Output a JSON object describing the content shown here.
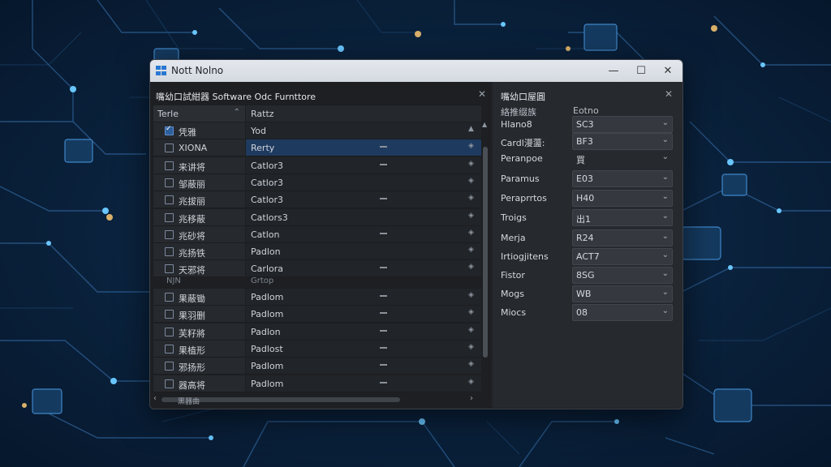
{
  "window": {
    "title": "Nott Nolno"
  },
  "left_panel": {
    "title": "嘴幼口試紺器 Software Odc Furnttore",
    "col1_header": "Terle",
    "col2_header": "Rattz",
    "rows": [
      {
        "name": "凭雅",
        "value": "Yod",
        "checked": true
      },
      {
        "name": "XIONA",
        "value": "Rerty",
        "selected": true
      },
      {
        "name": "来讲将",
        "value": "Catlor3"
      },
      {
        "name": "邹蔽丽",
        "value": "Catlor3"
      },
      {
        "name": "兆拔丽",
        "value": "Catlor3"
      },
      {
        "name": "兆移蔽",
        "value": "Catlors3"
      },
      {
        "name": "兆砂将",
        "value": "Catlon"
      },
      {
        "name": "兆扬铁",
        "value": "Padlon"
      },
      {
        "name": "天邪将",
        "value": "Carlora"
      },
      {
        "name": "果蔽锄",
        "value": "Padlom"
      },
      {
        "name": "果羽删",
        "value": "Padlom"
      },
      {
        "name": "芙籽將",
        "value": "Padlon"
      },
      {
        "name": "果植形",
        "value": "Padlost"
      },
      {
        "name": "邪扬形",
        "value": "Padlom"
      },
      {
        "name": "器高将",
        "value": "Padlom"
      }
    ],
    "group_left": "NJN",
    "group_right": "Grtop",
    "hscroll_label": "黑器曲"
  },
  "right_panel": {
    "title": "嘴幼口屋圓",
    "header_label": "絡推缀族",
    "header_value": "Eotno",
    "properties": [
      {
        "label": "Hlano8",
        "value": "SC3"
      },
      {
        "label": "Cardl漫蘯:",
        "value": "BF3"
      },
      {
        "label": "Peranpoe",
        "value": "買",
        "flat": true
      },
      {
        "label": "Paramus",
        "value": "E03"
      },
      {
        "label": "Peraprrtos",
        "value": "H40"
      },
      {
        "label": "Troigs",
        "value": "出1"
      },
      {
        "label": "Merja",
        "value": "R24"
      },
      {
        "label": "Irtiogjitens",
        "value": "ACT7"
      },
      {
        "label": "Fistor",
        "value": "8SG"
      },
      {
        "label": "Mogs",
        "value": "WB"
      },
      {
        "label": "Miocs",
        "value": "08"
      }
    ]
  },
  "icons": [
    "app-icon",
    "minimize-icon",
    "maximize-icon",
    "close-icon",
    "checkbox-icon",
    "dash-icon",
    "diamond-icon",
    "chevron-down-icon",
    "sort-icon"
  ]
}
